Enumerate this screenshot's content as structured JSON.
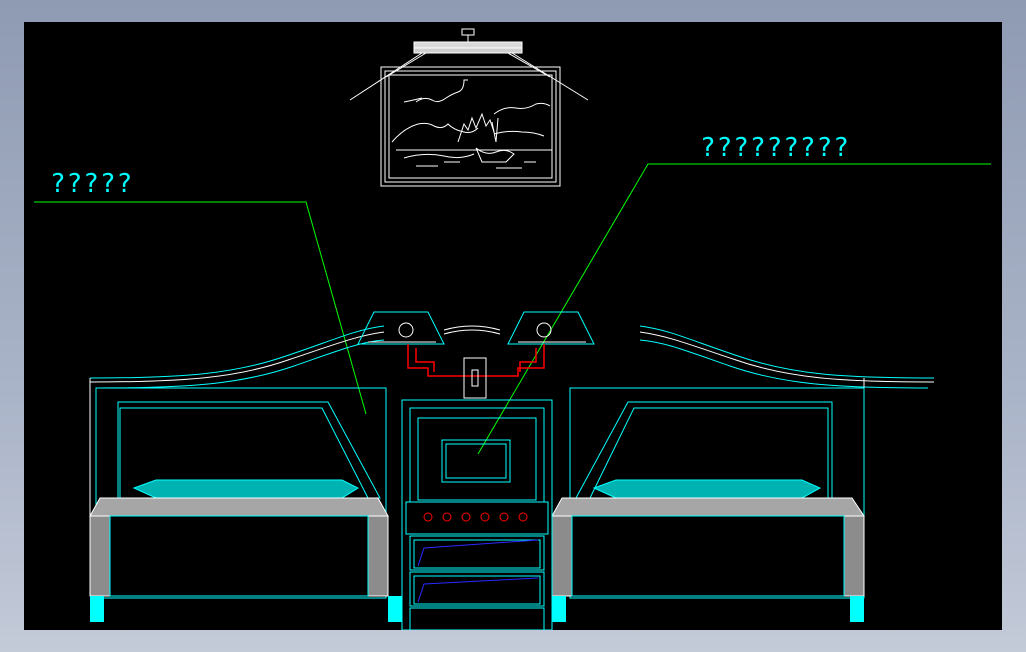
{
  "window": {
    "title": ""
  },
  "drawing": {
    "callout_left": "?????",
    "callout_right": "?????????"
  },
  "colors": {
    "background": "#000000",
    "frame_outer": "#9aa5bb",
    "cyan": "#00ffff",
    "white": "#ffffff",
    "green_leader": "#00ff00",
    "red": "#ff0000",
    "blue": "#0000ff",
    "grey_mattress": "#a6a6a6",
    "teal_pillow": "#00b3b3"
  },
  "icons": {
    "ceiling_lamp": "lamp-icon",
    "wall_painting": "painting-icon",
    "wall_lamp": "wall-lamp-icon",
    "bed": "bed-icon",
    "nightstand": "nightstand-icon"
  }
}
